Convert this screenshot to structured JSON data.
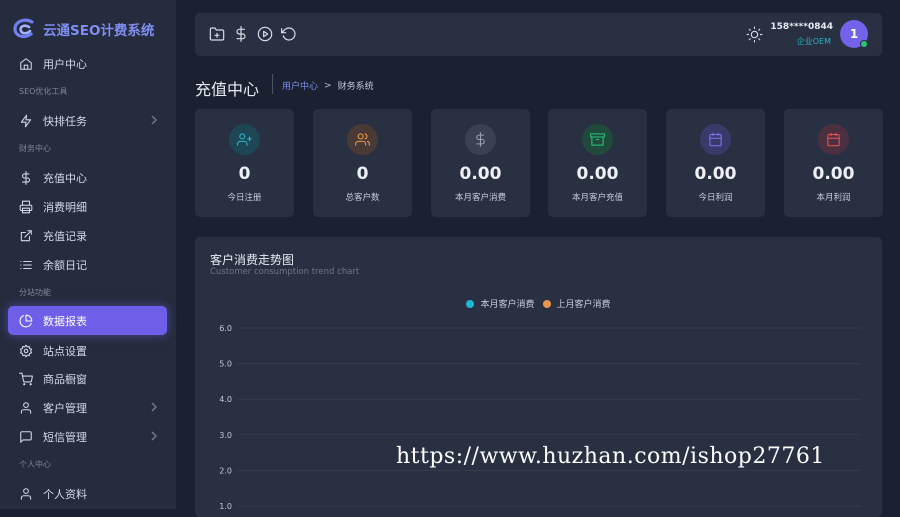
{
  "brand": {
    "name": "云通SEO计费系统"
  },
  "sidebar": {
    "items": [
      {
        "label": "用户中心",
        "icon": "home-icon"
      },
      {
        "section": "SEO优化工具"
      },
      {
        "label": "快排任务",
        "icon": "lightning-icon",
        "has_children": true
      },
      {
        "section": "财务中心"
      },
      {
        "label": "充值中心",
        "icon": "dollar-icon"
      },
      {
        "label": "消费明细",
        "icon": "printer-icon"
      },
      {
        "label": "充值记录",
        "icon": "external-link-icon"
      },
      {
        "label": "余额日记",
        "icon": "list-icon"
      },
      {
        "section": "分站功能"
      },
      {
        "label": "数据报表",
        "icon": "pie-chart-icon",
        "active": true
      },
      {
        "label": "站点设置",
        "icon": "gear-icon"
      },
      {
        "label": "商品橱窗",
        "icon": "cart-icon"
      },
      {
        "label": "客户管理",
        "icon": "user-icon",
        "has_children": true
      },
      {
        "label": "短信管理",
        "icon": "message-icon",
        "has_children": true
      },
      {
        "section": "个人中心"
      },
      {
        "label": "个人资料",
        "icon": "user-icon"
      }
    ]
  },
  "topbar": {
    "icons": [
      "folder-plus-icon",
      "dollar-icon",
      "play-circle-icon",
      "refresh-icon"
    ],
    "theme_icon": "sun-icon",
    "user": {
      "name": "158****0844",
      "role": "企业OEM",
      "avatar_text": "1",
      "online": true
    }
  },
  "page": {
    "title": "充值中心",
    "breadcrumb": {
      "link": "用户中心",
      "separator": ">",
      "current": "财务系统"
    }
  },
  "stats": [
    {
      "value": "0",
      "label": "今日注册",
      "icon": "user-plus-icon",
      "color": "#27b9cf"
    },
    {
      "value": "0",
      "label": "总客户数",
      "icon": "users-icon",
      "color": "#e8964d"
    },
    {
      "value": "0.00",
      "label": "本月客户消费",
      "icon": "dollar-icon",
      "color": "#9aa3b2"
    },
    {
      "value": "0.00",
      "label": "本月客户充值",
      "icon": "archive-icon",
      "color": "#29c777"
    },
    {
      "value": "0.00",
      "label": "今日利润",
      "icon": "calendar-icon",
      "color": "#7f75f0"
    },
    {
      "value": "0.00",
      "label": "本月利润",
      "icon": "calendar-icon",
      "color": "#ea5455"
    }
  ],
  "chart": {
    "title": "客户消费走势图",
    "subtitle": "Customer consumption trend chart"
  },
  "chart_data": {
    "type": "line",
    "legend_position": "top-center",
    "series": [
      {
        "name": "本月客户消费",
        "color": "#1fb7d6",
        "values": []
      },
      {
        "name": "上月客户消费",
        "color": "#e8964d",
        "values": []
      }
    ],
    "y_ticks": [
      "1.0",
      "2.0",
      "3.0",
      "4.0",
      "5.0",
      "6.0"
    ],
    "ylim": [
      1.0,
      6.0
    ],
    "grid": true
  },
  "watermark": "https://www.huzhan.com/ishop27761"
}
